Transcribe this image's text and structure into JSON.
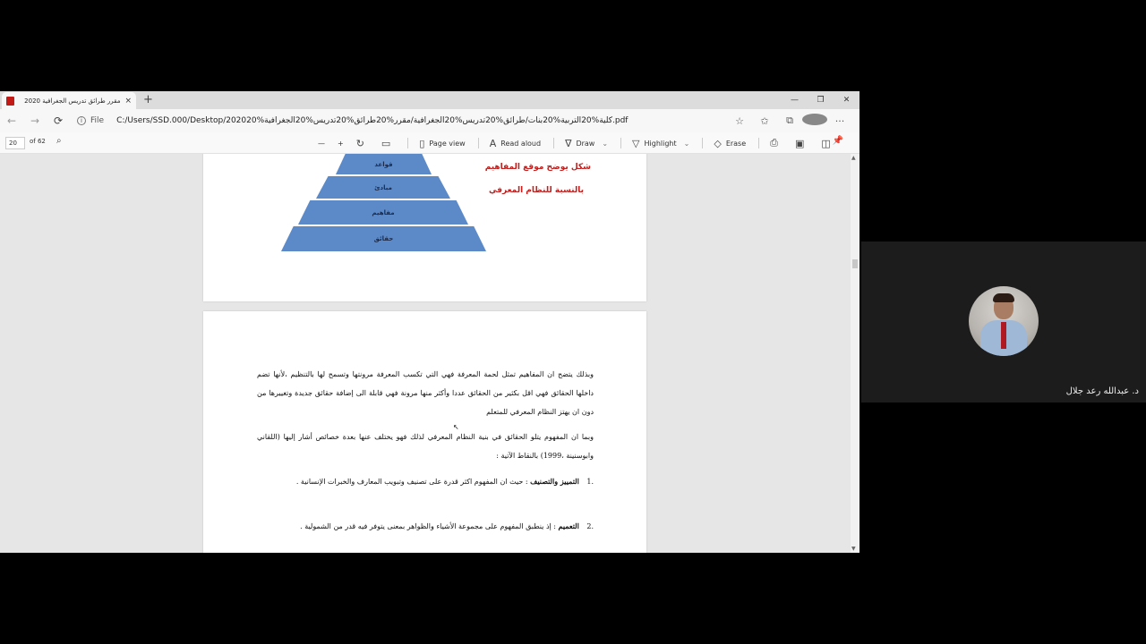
{
  "browser": {
    "tab_title": "مقرر طرائق تدريس الجغرافية 2020",
    "tab_close": "×",
    "new_tab": "+",
    "win_min": "—",
    "win_max": "❐",
    "win_close": "✕",
    "back": "←",
    "forward": "→",
    "refresh": "⟳",
    "file_label": "File",
    "url": "C:/Users/SSD.000/Desktop/كلية%20التربية%20بنات/طرائق%20تدريس%20الجغرافية/مقرر%20طرائق%20تدريس%20الجغرافية%202020.pdf",
    "more": "···"
  },
  "pdf_toolbar": {
    "page_current": "20",
    "page_total": "of 62",
    "zoom_out": "—",
    "zoom_in": "+",
    "page_view": "Page view",
    "read_aloud": "Read aloud",
    "draw": "Draw",
    "highlight": "Highlight",
    "erase": "Erase"
  },
  "document": {
    "pyramid": [
      "قواعد",
      "مبادئ",
      "مفاهيم",
      "حقائق"
    ],
    "caption_line1": "شكل يوضح موقع المفاهيم",
    "caption_line2": "بالنسبة للنظام المعرفي",
    "paragraph1": "وبذلك يتضح ان المفاهيم تمثل لحمة المعرفة فهي التي تكسب المعرفة مرونتها وتسمح لها بالتنظيم ،لأنها تضم داخلها الحقائق فهي اقل بكثير من الحقائق عددا وأكثر منها مرونة فهي قابلة الى إضافة حقائق جديدة وتغييرها من دون ان يهتز النظام المعرفي للمتعلم",
    "paragraph2": "وبما ان المفهوم يتلو الحقائق في بنية النظام المعرفي لذلك فهو يختلف عنها بعدة خصائص أشار إليها (اللقاني وابوسنينة ،1999) بالنقاط الآتية :",
    "item1_num": ".1",
    "item1_term": "التمييز والتصنيف",
    "item1_text": ": حيث ان المفهوم اكثر قدرة على تصنيف وتبويب المعارف والخبرات الإنسانية .",
    "item2_num": ".2",
    "item2_term": "التعميم",
    "item2_text": ": إذ ينطبق المفهوم على مجموعة الأشياء والظواهر بمعنى يتوفر فيه قدر من الشمولية ."
  },
  "participant": {
    "name": "د. عبدالله رعد جلال"
  }
}
